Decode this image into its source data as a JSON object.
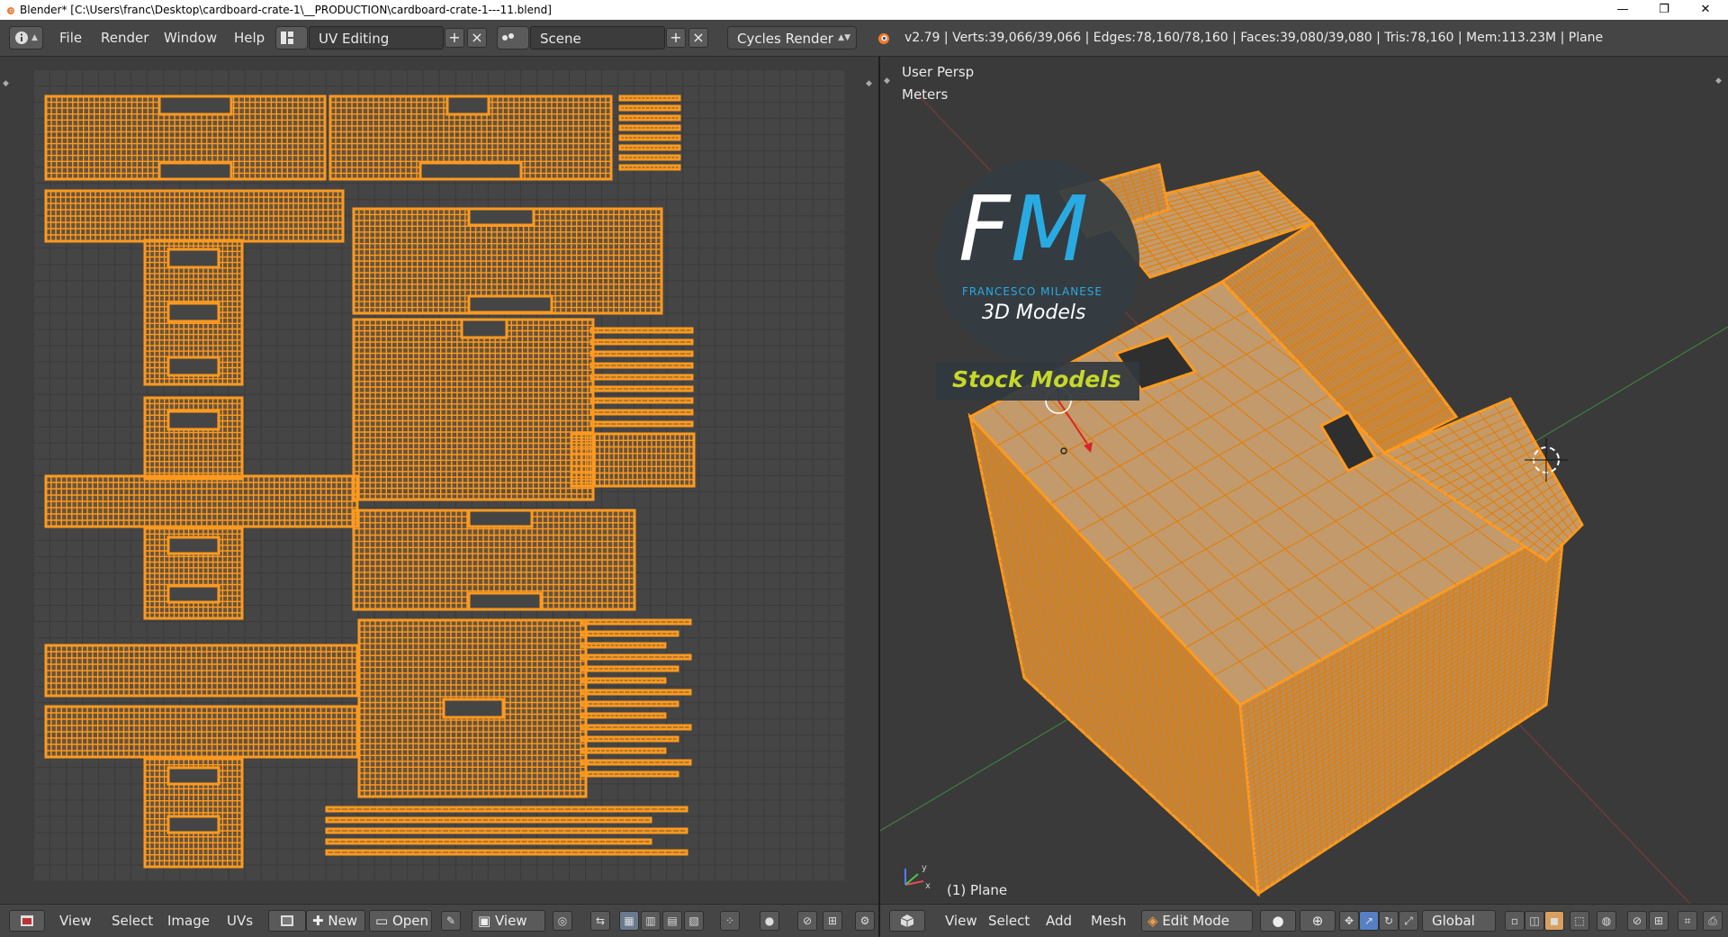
{
  "window": {
    "title": "Blender* [C:\\Users\\franc\\Desktop\\cardboard-crate-1\\__PRODUCTION\\cardboard-crate-1---11.blend]",
    "minimize": "—",
    "maximize": "❐",
    "close": "✕"
  },
  "infobar": {
    "menus": [
      "File",
      "Render",
      "Window",
      "Help"
    ],
    "screen_layout": "UV Editing",
    "scene": "Scene",
    "render_engine": "Cycles Render",
    "stats": "v2.79 | Verts:39,066/39,066 | Edges:78,160/78,160 | Faces:39,080/39,080 | Tris:78,160 | Mem:113.23M | Plane"
  },
  "viewport": {
    "view_name": "User Persp",
    "units": "Meters",
    "object_label": "(1) Plane",
    "logo": {
      "letters_f": "F",
      "letters_m": "M",
      "brand": "FRANCESCO MILANESE",
      "tagline": "3D Models",
      "banner": "Stock Models"
    }
  },
  "uv_footer": {
    "view": "View",
    "select": "Select",
    "image": "Image",
    "uvs": "UVs",
    "new": "New",
    "open": "Open",
    "view_menu": "View"
  },
  "vp_footer": {
    "view": "View",
    "select": "Select",
    "add": "Add",
    "mesh": "Mesh",
    "mode": "Edit Mode",
    "orientation": "Global"
  },
  "colors": {
    "wire": "#ff9a1f",
    "wire_dark": "#e47c00",
    "face": "#c29a6c",
    "logo_blue": "#29aae2",
    "banner_text": "#c6d82a"
  }
}
